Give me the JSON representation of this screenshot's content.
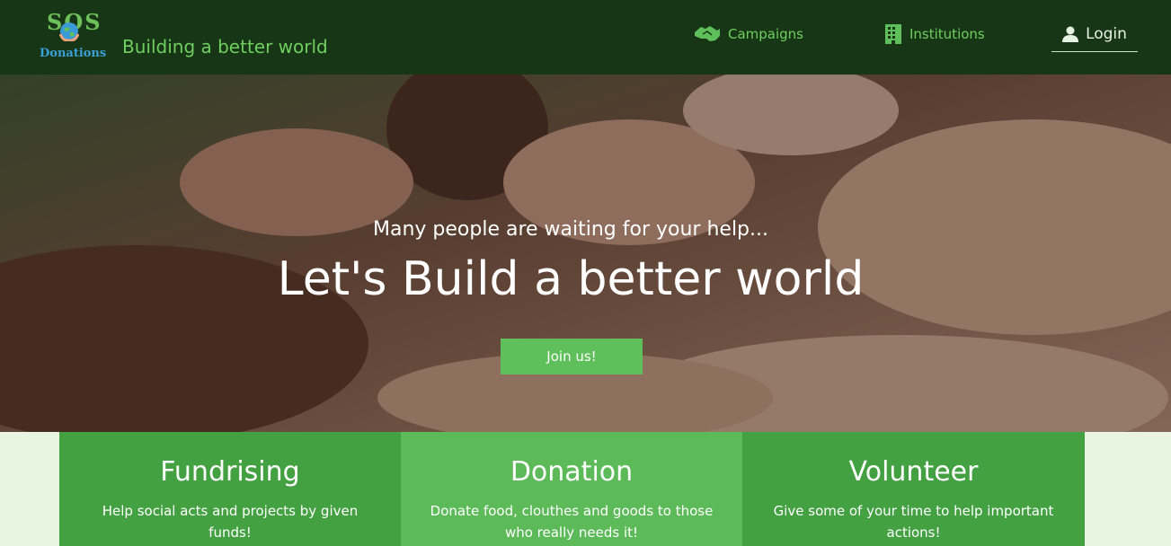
{
  "header": {
    "logo_text_top": "SOS",
    "logo_text_bottom": "Donations",
    "tagline": "Building a better world",
    "nav": {
      "campaigns_label": "Campaigns",
      "institutions_label": "Institutions",
      "login_label": "Login"
    }
  },
  "hero": {
    "subtitle": "Many people are waiting for your help...",
    "title": "Let's Build a better world",
    "cta_label": "Join us!"
  },
  "cards": [
    {
      "title": "Fundrising",
      "text": "Help social acts and projects by given funds!"
    },
    {
      "title": "Donation",
      "text": "Donate food, clouthes and goods to those who really needs it!"
    },
    {
      "title": "Volunteer",
      "text": "Give some of your time to help important actions!"
    }
  ],
  "colors": {
    "header_bg": "#173616",
    "accent_green": "#6fcf5f",
    "button_green": "#5fbf5a",
    "card_dark": "#43a142",
    "card_light": "#5cba59",
    "page_bg": "#e8f5e1"
  },
  "icons": {
    "campaigns": "handshake-icon",
    "institutions": "building-icon",
    "login": "user-icon"
  }
}
